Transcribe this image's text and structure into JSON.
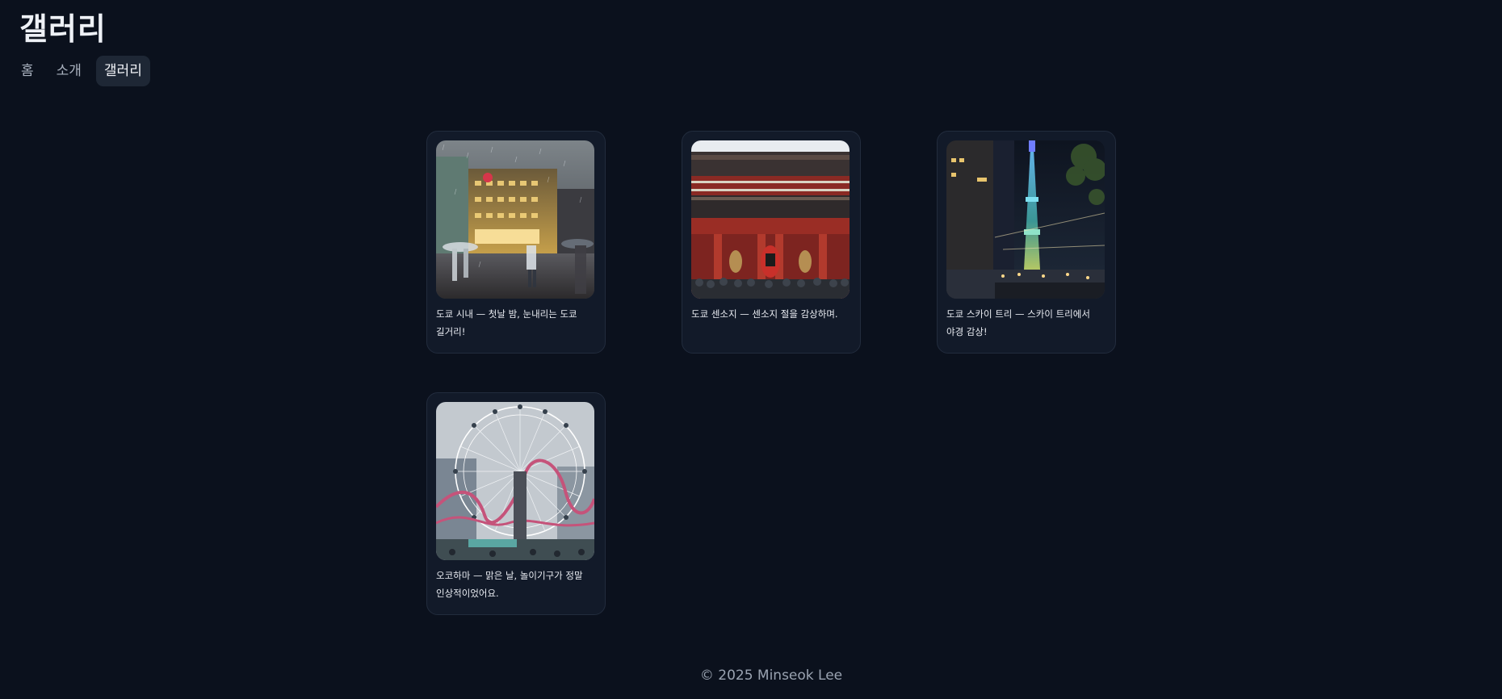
{
  "site": {
    "title": "갤러리"
  },
  "nav": {
    "items": [
      {
        "label": "홈",
        "active": false
      },
      {
        "label": "소개",
        "active": false
      },
      {
        "label": "갤러리",
        "active": true
      }
    ]
  },
  "gallery": {
    "cards": [
      {
        "caption": "도쿄 시내 — 첫날 밤, 눈내리는 도쿄 길거리!",
        "photo": "tokyo-street-night-snow"
      },
      {
        "caption": "도쿄 센소지 — 센소지 절을 감상하며.",
        "photo": "sensoji-temple"
      },
      {
        "caption": "도쿄 스카이 트리 — 스카이 트리에서 야경 감상!",
        "photo": "tokyo-skytree-night"
      },
      {
        "caption": "오코하마 — 맑은 날, 놀이기구가 정말 인상적이었어요.",
        "photo": "yokohama-ferris-wheel"
      }
    ]
  },
  "footer": {
    "text": "© 2025 Minseok Lee"
  },
  "colors": {
    "background": "#0b111d",
    "card": "#121a29",
    "nav_active": "#1e2735"
  }
}
